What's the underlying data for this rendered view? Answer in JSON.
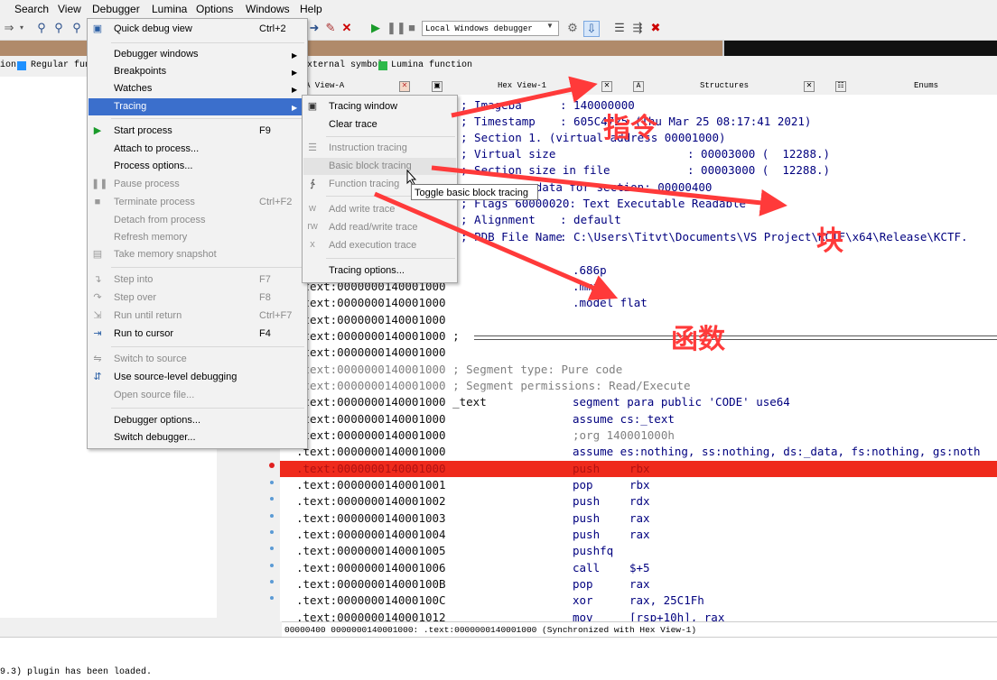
{
  "menubar": [
    "Search",
    "View",
    "Debugger",
    "Lumina",
    "Options",
    "Windows",
    "Help"
  ],
  "toolbar": {
    "debugger_combo": "Local Windows debugger"
  },
  "legend": {
    "regular": "Regular func",
    "external": "xternal symbol",
    "lumina": "Lumina function",
    "left_fragment": "ion"
  },
  "tabs": {
    "ida_view": "A View-A",
    "hex_view": "Hex View-1",
    "structures": "Structures",
    "enums": "Enums"
  },
  "debugger_menu": {
    "items": [
      {
        "label": "Quick debug view",
        "shortcut": "Ctrl+2"
      },
      {
        "label": "Debugger windows"
      },
      {
        "label": "Breakpoints"
      },
      {
        "label": "Watches"
      },
      {
        "label": "Tracing"
      },
      {
        "label": "Start process",
        "shortcut": "F9"
      },
      {
        "label": "Attach to process..."
      },
      {
        "label": "Process options..."
      },
      {
        "label": "Pause process"
      },
      {
        "label": "Terminate process",
        "shortcut": "Ctrl+F2"
      },
      {
        "label": "Detach from process"
      },
      {
        "label": "Refresh memory"
      },
      {
        "label": "Take memory snapshot"
      },
      {
        "label": "Step into",
        "shortcut": "F7"
      },
      {
        "label": "Step over",
        "shortcut": "F8"
      },
      {
        "label": "Run until return",
        "shortcut": "Ctrl+F7"
      },
      {
        "label": "Run to cursor",
        "shortcut": "F4"
      },
      {
        "label": "Switch to source"
      },
      {
        "label": "Use source-level debugging"
      },
      {
        "label": "Open source file..."
      },
      {
        "label": "Debugger options..."
      },
      {
        "label": "Switch debugger..."
      }
    ]
  },
  "tracing_menu": {
    "items": [
      {
        "label": "Tracing window"
      },
      {
        "label": "Clear trace"
      },
      {
        "label": "Instruction tracing"
      },
      {
        "label": "Basic block tracing"
      },
      {
        "label": "Function tracing"
      },
      {
        "label": "Add write trace"
      },
      {
        "label": "Add read/write trace"
      },
      {
        "label": "Add execution trace"
      },
      {
        "label": "Tracing options..."
      }
    ]
  },
  "tooltip": "Toggle basic block tracing",
  "header_lines": [
    {
      "label": "; Imageba",
      "value": ": 140000000"
    },
    {
      "label": "; Timestamp",
      "value": ": 605C4725 (Thu Mar 25 08:17:41 2021)"
    },
    {
      "label": "; Section 1. (virtual address 00001000)",
      "value": ""
    },
    {
      "label": "; Virtual size",
      "value": ": 00003000 (  12288.)"
    },
    {
      "label": "; Section size in file",
      "value": ": 00003000 (  12288.)"
    },
    {
      "label": "; ...  raw data for section: 00000400",
      "value": ""
    },
    {
      "label": "; Flags 60000020: Text Executable Readable",
      "value": ""
    },
    {
      "label": "; Alignment",
      "value": ": default"
    },
    {
      "label": "; PDB File Name",
      "value": ": C:\\Users\\Titvt\\Documents\\VS Project\\KCTF\\x64\\Release\\KCTF."
    }
  ],
  "listing": [
    {
      "addr": "",
      "col2": ".686p",
      "col3": ""
    },
    {
      "addr": ".text:0000000140001000",
      "col2": ".mmx",
      "col3": ""
    },
    {
      "addr": ".text:0000000140001000",
      "col2": ".model flat",
      "col3": ""
    },
    {
      "addr": ".text:0000000140001000",
      "col2": "",
      "col3": ""
    },
    {
      "addr": ".text:0000000140001000 ;",
      "col2": "",
      "col3": ""
    },
    {
      "addr": ".text:0000000140001000",
      "col2": "",
      "col3": ""
    },
    {
      "addr": ".text:0000000140001000 ; Segment type: Pure code",
      "col2": "",
      "col3": ""
    },
    {
      "addr": ".text:0000000140001000 ; Segment permissions: Read/Execute",
      "col2": "",
      "col3": ""
    },
    {
      "addr": ".text:0000000140001000 _text",
      "col2": "segment para public 'CODE' use64",
      "col3": ""
    },
    {
      "addr": ".text:0000000140001000",
      "col2": "assume cs:_text",
      "col3": ""
    },
    {
      "addr": ".text:0000000140001000",
      "col2": ";org 140001000h",
      "col3": ""
    },
    {
      "addr": ".text:0000000140001000",
      "col2": "assume es:nothing, ss:nothing, ds:_data, fs:nothing, gs:noth",
      "col3": ""
    },
    {
      "addr": ".text:0000000140001000",
      "col2": "push",
      "col3": "rbx"
    },
    {
      "addr": ".text:0000000140001001",
      "col2": "pop",
      "col3": "rbx"
    },
    {
      "addr": ".text:0000000140001002",
      "col2": "push",
      "col3": "rdx"
    },
    {
      "addr": ".text:0000000140001003",
      "col2": "push",
      "col3": "rax"
    },
    {
      "addr": ".text:0000000140001004",
      "col2": "push",
      "col3": "rax"
    },
    {
      "addr": ".text:0000000140001005",
      "col2": "pushfq",
      "col3": ""
    },
    {
      "addr": ".text:0000000140001006",
      "col2": "call",
      "col3": "$+5"
    },
    {
      "addr": ".text:000000014000100B",
      "col2": "pop",
      "col3": "rax"
    },
    {
      "addr": ".text:000000014000100C",
      "col2": "xor",
      "col3": "rax, 25C1Fh"
    },
    {
      "addr": ".text:0000000140001012",
      "col2": "mov",
      "col3": "[rsp+10h], rax"
    }
  ],
  "status": "00000400 0000000140001000: .text:0000000140001000 (Synchronized with Hex View-1)",
  "output_text": "9.3) plugin has been loaded.",
  "annotations": {
    "instruction": "指令",
    "block": "块",
    "function": "函数"
  },
  "colors": {
    "highlight": "#3b6fcc",
    "breakpoint_line": "#ef2a1c",
    "annotation": "#ff3a3a",
    "regular_func": "#1e90ff",
    "lumina_func": "#2db84a"
  }
}
